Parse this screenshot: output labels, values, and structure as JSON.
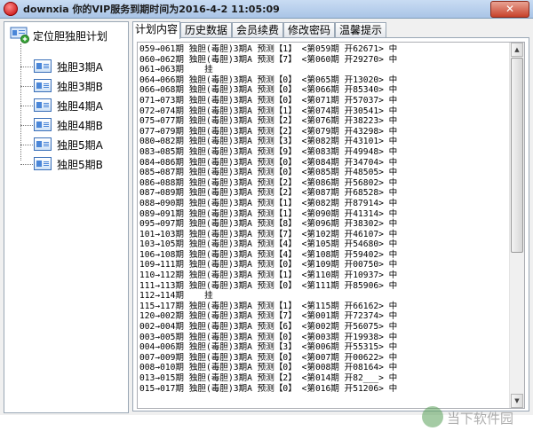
{
  "window": {
    "title": "downxia 你的VIP服务到期时间为2016-4-2 11:05:09",
    "close_label": "✕"
  },
  "tree": {
    "root_label": "定位胆独胆计划",
    "items": [
      {
        "label": "独胆3期A"
      },
      {
        "label": "独胆3期B"
      },
      {
        "label": "独胆4期A"
      },
      {
        "label": "独胆4期B"
      },
      {
        "label": "独胆5期A"
      },
      {
        "label": "独胆5期B"
      }
    ]
  },
  "tabs": [
    {
      "label": "计划内容",
      "active": true
    },
    {
      "label": "历史数据",
      "active": false
    },
    {
      "label": "会员续费",
      "active": false
    },
    {
      "label": "修改密码",
      "active": false
    },
    {
      "label": "温馨提示",
      "active": false
    }
  ],
  "content": {
    "lines": [
      "059→061期 独胆(毒胆)3期A 预测【1】 <第059期 开62671> 中",
      "060→062期 独胆(毒胆)3期A 预测【7】 <第060期 开29270> 中",
      "061→063期    挂",
      "064→066期 独胆(毒胆)3期A 预测【0】 <第065期 开13020> 中",
      "066→068期 独胆(毒胆)3期A 预测【0】 <第066期 开85340> 中",
      "071→073期 独胆(毒胆)3期A 预测【0】 <第071期 开57037> 中",
      "072→074期 独胆(毒胆)3期A 预测【1】 <第074期 开30541> 中",
      "075→077期 独胆(毒胆)3期A 预测【2】 <第076期 开38223> 中",
      "077→079期 独胆(毒胆)3期A 预测【2】 <第079期 开43298> 中",
      "080→082期 独胆(毒胆)3期A 预测【3】 <第082期 开43101> 中",
      "083→085期 独胆(毒胆)3期A 预测【9】 <第083期 开49948> 中",
      "084→086期 独胆(毒胆)3期A 预测【0】 <第084期 开34704> 中",
      "085→087期 独胆(毒胆)3期A 预测【0】 <第085期 开48505> 中",
      "086→088期 独胆(毒胆)3期A 预测【2】 <第086期 开56802> 中",
      "087→089期 独胆(毒胆)3期A 预测【2】 <第087期 开68528> 中",
      "088→090期 独胆(毒胆)3期A 预测【1】 <第082期 开87914> 中",
      "089→091期 独胆(毒胆)3期A 预测【1】 <第090期 开41314> 中",
      "095→097期 独胆(毒胆)3期A 预测【8】 <第096期 开38302> 中",
      "101→103期 独胆(毒胆)3期A 预测【7】 <第102期 开46107> 中",
      "103→105期 独胆(毒胆)3期A 预测【4】 <第105期 开54680> 中",
      "106→108期 独胆(毒胆)3期A 预测【4】 <第108期 开59402> 中",
      "109→111期 独胆(毒胆)3期A 预测【0】 <第109期 开00750> 中",
      "110→112期 独胆(毒胆)3期A 预测【1】 <第110期 开10937> 中",
      "111→113期 独胆(毒胆)3期A 预测【0】 <第111期 开85906> 中",
      "112→114期    挂",
      "115→117期 独胆(毒胆)3期A 预测【1】 <第115期 开66162> 中",
      "120→002期 独胆(毒胆)3期A 预测【7】 <第001期 开72374> 中",
      "002→004期 独胆(毒胆)3期A 预测【6】 <第002期 开56075> 中",
      "003→005期 独胆(毒胆)3期A 预测【0】 <第003期 开19938> 中",
      "004→006期 独胆(毒胆)3期A 预测【3】 <第006期 开55315> 中",
      "007→009期 独胆(毒胆)3期A 预测【0】 <第007期 开00622> 中",
      "008→010期 独胆(毒胆)3期A 预测【0】 <第008期 开08164> 中",
      "013→015期 独胆(毒胆)3期A 预测【2】 <第014期 开82___> 中",
      "015→017期 独胆(毒胆)3期A 预测【0】 <第016期 开51206> 中"
    ]
  },
  "watermark": {
    "text": "当下软件园"
  }
}
